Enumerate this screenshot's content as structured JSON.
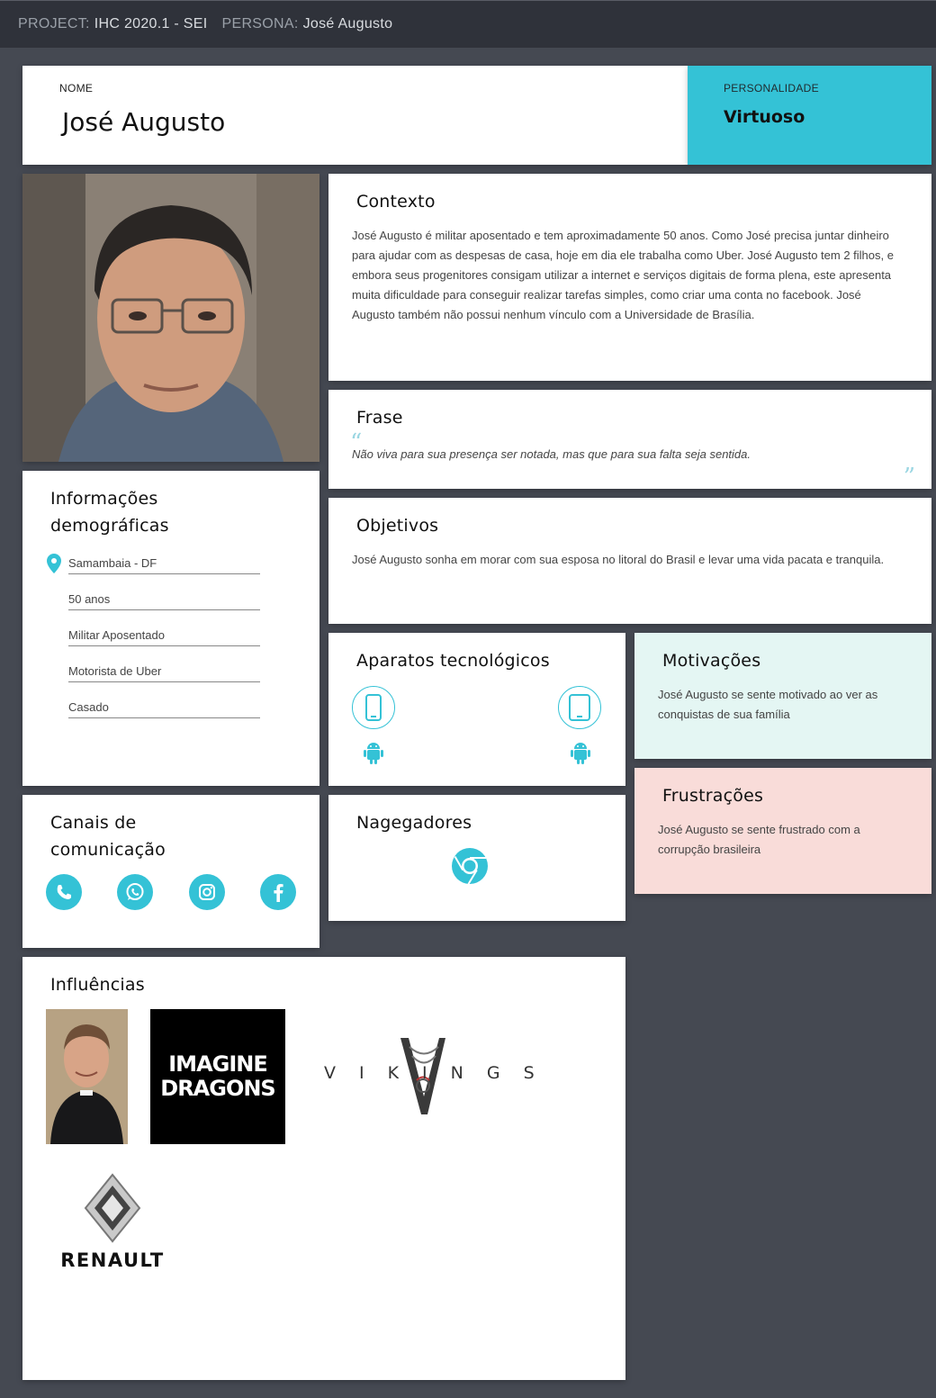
{
  "topbar": {
    "project_key": "PROJECT:",
    "project_value": "IHC 2020.1 - SEI",
    "persona_key": "PERSONA:",
    "persona_value": "José Augusto"
  },
  "header": {
    "name_label": "NOME",
    "name": "José Augusto",
    "personality_label": "PERSONALIDADE",
    "personality": "Virtuoso"
  },
  "context": {
    "title": "Contexto",
    "text": "José Augusto é militar aposentado e tem aproximadamente 50 anos. Como José precisa juntar dinheiro para ajudar com as despesas de casa, hoje em dia ele trabalha como Uber. José Augusto tem 2 filhos, e embora seus progenitores consigam utilizar a internet e serviços digitais de forma plena, este apresenta muita dificuldade para conseguir realizar tarefas simples, como criar uma conta no facebook. José Augusto também não possui nenhum vínculo com a Universidade de Brasília."
  },
  "quote": {
    "title": "Frase",
    "open": "“",
    "close": "”",
    "text": "Não viva para sua presença ser notada, mas que para sua falta seja sentida."
  },
  "goals": {
    "title": "Objetivos",
    "text": "José Augusto sonha em morar com sua esposa no litoral do Brasil e levar uma vida pacata e tranquila."
  },
  "demographics": {
    "title": "Informações demográficas",
    "items": [
      "Samambaia - DF",
      "50 anos",
      "Militar Aposentado",
      "Motorista de Uber",
      "Casado"
    ],
    "location_icon": "map-pin-icon"
  },
  "tech": {
    "title": "Aparatos tecnológicos",
    "devices": [
      {
        "icon": "smartphone-icon",
        "os_icon": "android-icon"
      },
      {
        "icon": "tablet-icon",
        "os_icon": "android-icon"
      }
    ]
  },
  "motivations": {
    "title": "Motivações",
    "text": "José Augusto se sente motivado ao ver as conquistas de sua família"
  },
  "frustrations": {
    "title": "Frustrações",
    "text": "José Augusto se sente frustrado com a corrupção brasileira"
  },
  "channels": {
    "title": "Canais de comunicação",
    "icons": [
      "phone-icon",
      "whatsapp-icon",
      "instagram-icon",
      "facebook-icon"
    ]
  },
  "browsers": {
    "title": "Nagegadores",
    "icons": [
      "chrome-icon"
    ]
  },
  "influences": {
    "title": "Influências",
    "logos": {
      "imagine_line1": "IMAGINE",
      "imagine_line2": "DRAGONS",
      "vikings": "VIKINGS",
      "renault": "RENAULT"
    }
  },
  "colors": {
    "accent": "#34c2d6",
    "background": "#454952",
    "topbar": "#2f323a",
    "motivations_bg": "#e4f6f3",
    "frustrations_bg": "#f9dcd9"
  }
}
